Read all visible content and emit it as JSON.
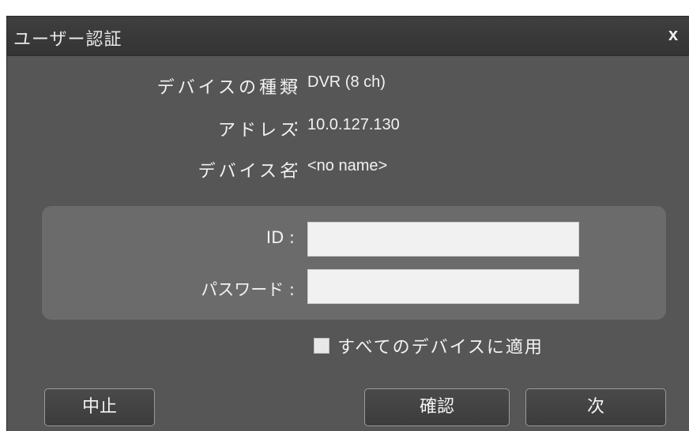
{
  "dialog": {
    "title": "ユーザー認証",
    "close_label": "x"
  },
  "info": {
    "device_type_label": "デバイスの種類",
    "device_type_value": "DVR (8 ch)",
    "address_label": "アドレス",
    "address_value": "10.0.127.130",
    "device_name_label": "デバイス名",
    "device_name_value": "<no name>",
    "separator": ":"
  },
  "credentials": {
    "id_label": "ID :",
    "id_value": "",
    "password_label": "パスワード :",
    "password_value": ""
  },
  "apply_all": {
    "label": "すべてのデバイスに適用",
    "checked": false
  },
  "buttons": {
    "cancel": "中止",
    "confirm": "確認",
    "next": "次"
  }
}
